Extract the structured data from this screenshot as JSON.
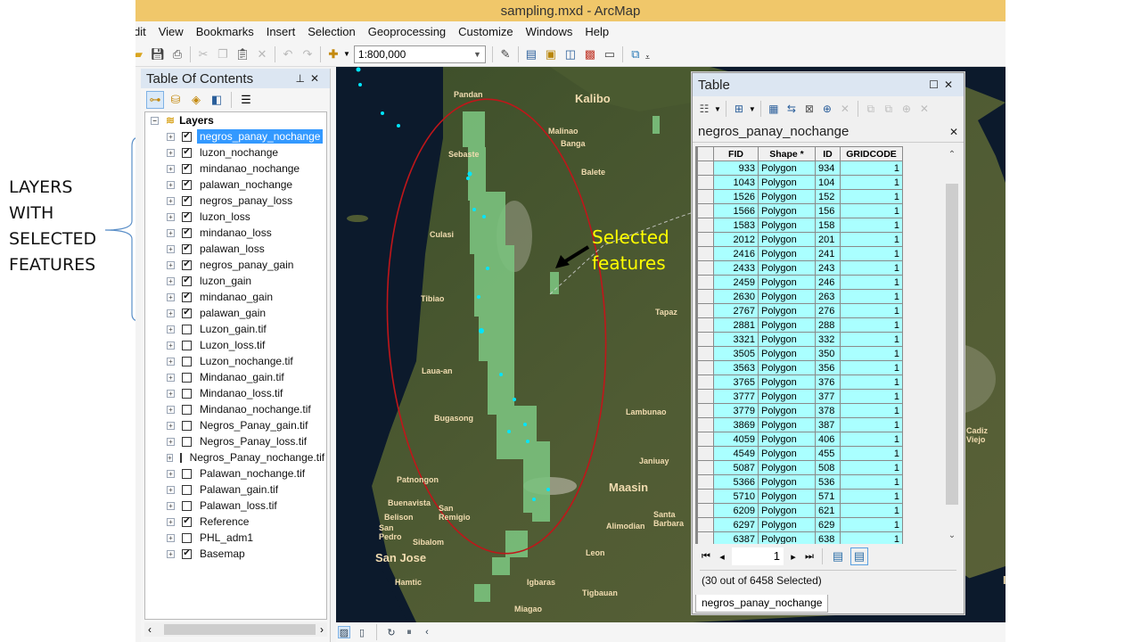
{
  "annotation": {
    "lines": [
      "LAYERS",
      "WITH",
      "SELECTED",
      "FEATURES"
    ],
    "callout": [
      "Selected",
      "features"
    ]
  },
  "window": {
    "title": "sampling.mxd - ArcMap"
  },
  "menu": [
    "dit",
    "View",
    "Bookmarks",
    "Insert",
    "Selection",
    "Geoprocessing",
    "Customize",
    "Windows",
    "Help"
  ],
  "toolbar": {
    "scale": "1:800,000",
    "icons": [
      "open-icon",
      "save-icon",
      "print-icon",
      "cut-icon",
      "copy-icon",
      "paste-icon",
      "delete-icon",
      "undo-icon",
      "redo-icon",
      "add-data-icon",
      "editor-icon",
      "toc-window-icon",
      "catalog-icon",
      "search-icon",
      "arctoolbox-icon",
      "python-icon",
      "modelbuilder-icon"
    ]
  },
  "toc": {
    "title": "Table Of Contents",
    "root": "Layers",
    "layers": [
      {
        "name": "negros_panay_nochange",
        "checked": true,
        "selected": true
      },
      {
        "name": "luzon_nochange",
        "checked": true
      },
      {
        "name": "mindanao_nochange",
        "checked": true
      },
      {
        "name": "palawan_nochange",
        "checked": true
      },
      {
        "name": "negros_panay_loss",
        "checked": true
      },
      {
        "name": "luzon_loss",
        "checked": true
      },
      {
        "name": "mindanao_loss",
        "checked": true
      },
      {
        "name": "palawan_loss",
        "checked": true
      },
      {
        "name": "negros_panay_gain",
        "checked": true
      },
      {
        "name": "luzon_gain",
        "checked": true
      },
      {
        "name": "mindanao_gain",
        "checked": true
      },
      {
        "name": "palawan_gain",
        "checked": true
      },
      {
        "name": "Luzon_gain.tif",
        "checked": false
      },
      {
        "name": "Luzon_loss.tif",
        "checked": false
      },
      {
        "name": "Luzon_nochange.tif",
        "checked": false
      },
      {
        "name": "Mindanao_gain.tif",
        "checked": false
      },
      {
        "name": "Mindanao_loss.tif",
        "checked": false
      },
      {
        "name": "Mindanao_nochange.tif",
        "checked": false
      },
      {
        "name": "Negros_Panay_gain.tif",
        "checked": false
      },
      {
        "name": "Negros_Panay_loss.tif",
        "checked": false
      },
      {
        "name": "Negros_Panay_nochange.tif",
        "checked": false
      },
      {
        "name": "Palawan_nochange.tif",
        "checked": false
      },
      {
        "name": "Palawan_gain.tif",
        "checked": false
      },
      {
        "name": "Palawan_loss.tif",
        "checked": false
      },
      {
        "name": "Reference",
        "checked": true
      },
      {
        "name": "PHL_adm1",
        "checked": false
      },
      {
        "name": "Basemap",
        "checked": true
      }
    ]
  },
  "map": {
    "labels": [
      {
        "text": "Kalibo",
        "big": true
      },
      {
        "text": "Pandan"
      },
      {
        "text": "Malinao"
      },
      {
        "text": "Banga"
      },
      {
        "text": "Sebaste"
      },
      {
        "text": "Balete"
      },
      {
        "text": "Culasi"
      },
      {
        "text": "Tibiao"
      },
      {
        "text": "Tapaz"
      },
      {
        "text": "Laua-an"
      },
      {
        "text": "Bugasong"
      },
      {
        "text": "Lambunao"
      },
      {
        "text": "Janiuay"
      },
      {
        "text": "Maasin",
        "big": true
      },
      {
        "text": "Patnongon"
      },
      {
        "text": "Buenavista"
      },
      {
        "text": "San Remigio"
      },
      {
        "text": "Belison"
      },
      {
        "text": "San Pedro"
      },
      {
        "text": "Sibalom"
      },
      {
        "text": "San Jose",
        "big": true
      },
      {
        "text": "Hamtic"
      },
      {
        "text": "Alimodian"
      },
      {
        "text": "Leon"
      },
      {
        "text": "Santa Barbara"
      },
      {
        "text": "Igbaras"
      },
      {
        "text": "Tigbauan"
      },
      {
        "text": "Miagao"
      },
      {
        "text": "Iloilo",
        "big": true
      },
      {
        "text": "Cadiz Viejo"
      }
    ]
  },
  "table": {
    "title": "Table",
    "layer": "negros_panay_nochange",
    "columns": [
      "FID",
      "Shape *",
      "ID",
      "GRIDCODE"
    ],
    "rows": [
      [
        "933",
        "Polygon",
        "934",
        "1"
      ],
      [
        "1043",
        "Polygon",
        "104",
        "1"
      ],
      [
        "1526",
        "Polygon",
        "152",
        "1"
      ],
      [
        "1566",
        "Polygon",
        "156",
        "1"
      ],
      [
        "1583",
        "Polygon",
        "158",
        "1"
      ],
      [
        "2012",
        "Polygon",
        "201",
        "1"
      ],
      [
        "2416",
        "Polygon",
        "241",
        "1"
      ],
      [
        "2433",
        "Polygon",
        "243",
        "1"
      ],
      [
        "2459",
        "Polygon",
        "246",
        "1"
      ],
      [
        "2630",
        "Polygon",
        "263",
        "1"
      ],
      [
        "2767",
        "Polygon",
        "276",
        "1"
      ],
      [
        "2881",
        "Polygon",
        "288",
        "1"
      ],
      [
        "3321",
        "Polygon",
        "332",
        "1"
      ],
      [
        "3505",
        "Polygon",
        "350",
        "1"
      ],
      [
        "3563",
        "Polygon",
        "356",
        "1"
      ],
      [
        "3765",
        "Polygon",
        "376",
        "1"
      ],
      [
        "3777",
        "Polygon",
        "377",
        "1"
      ],
      [
        "3779",
        "Polygon",
        "378",
        "1"
      ],
      [
        "3869",
        "Polygon",
        "387",
        "1"
      ],
      [
        "4059",
        "Polygon",
        "406",
        "1"
      ],
      [
        "4549",
        "Polygon",
        "455",
        "1"
      ],
      [
        "5087",
        "Polygon",
        "508",
        "1"
      ],
      [
        "5366",
        "Polygon",
        "536",
        "1"
      ],
      [
        "5710",
        "Polygon",
        "571",
        "1"
      ],
      [
        "6209",
        "Polygon",
        "621",
        "1"
      ],
      [
        "6297",
        "Polygon",
        "629",
        "1"
      ],
      [
        "6387",
        "Polygon",
        "638",
        "1"
      ]
    ],
    "page": "1",
    "status": "(30 out of 6458 Selected)",
    "tab": "negros_panay_nochange"
  }
}
